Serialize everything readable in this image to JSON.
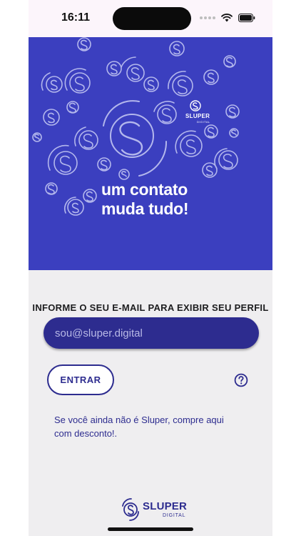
{
  "status_bar": {
    "time": "16:11"
  },
  "hero": {
    "tagline_line1": "um contato",
    "tagline_line2": "muda tudo!",
    "badge_brand": "SLUPER",
    "badge_sub": "DIGITAL",
    "background_color": "#3b3fbf"
  },
  "form": {
    "prompt": "INFORME O SEU E-MAIL PARA EXIBIR SEU PERFIL",
    "email_placeholder": "sou@sluper.digital",
    "email_value": "",
    "enter_label": "ENTRAR",
    "help_icon": "question-circle-icon",
    "promo_text": "Se você ainda não é Sluper, compre aqui com desconto!."
  },
  "footer": {
    "brand": "SLUPER",
    "sub": "DIGITAL"
  },
  "colors": {
    "accent": "#2d2c8f",
    "hero": "#3b3fbf",
    "background": "#efeef0"
  }
}
